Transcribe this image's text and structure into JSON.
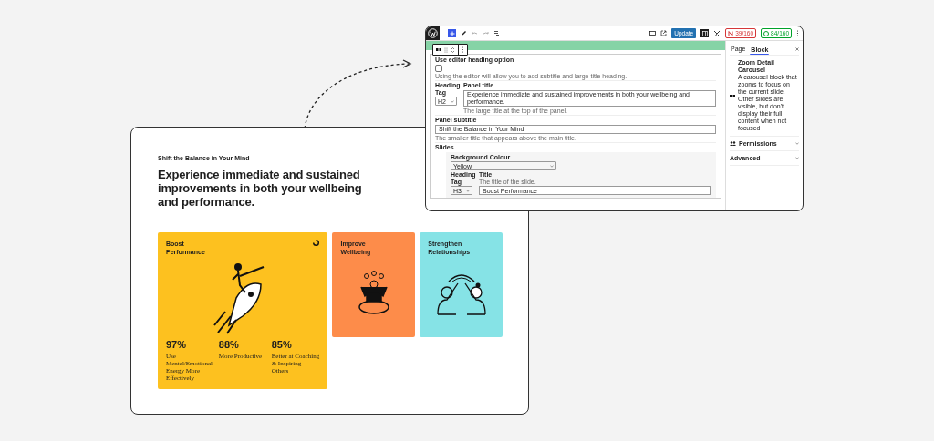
{
  "page_preview": {
    "subtitle": "Shift the Balance in Your Mind",
    "title": "Experience immediate and sustained improvements in both your wellbeing and performance.",
    "cards": [
      {
        "kind": "rocket",
        "title": "Boost Performance",
        "color": "#fdc11f",
        "expanded": true,
        "stats": [
          {
            "value": "97%",
            "label": "Use Mental/Emotional Energy More Effectively"
          },
          {
            "value": "88%",
            "label": "More Productive"
          },
          {
            "value": "85%",
            "label": "Better at Coaching & Inspiring Others"
          }
        ]
      },
      {
        "kind": "meditation",
        "title": "Improve Wellbeing",
        "color": "#fd8c4a",
        "expanded": false
      },
      {
        "kind": "high-five",
        "title": "Strengthen Relationships",
        "color": "#86e3e6",
        "expanded": false
      }
    ]
  },
  "editor": {
    "update_button": "Update",
    "badges": [
      {
        "text": "39/160",
        "color": "#d63638"
      },
      {
        "text": "84/160",
        "color": "#00a32a"
      }
    ],
    "form": {
      "editor_heading": {
        "label": "Use editor heading option",
        "checked": false,
        "help": "Using the editor will allow you to add subtitle and large title heading."
      },
      "heading_tag": {
        "label": "Heading Tag",
        "value": "H2"
      },
      "panel_title": {
        "label": "Panel title",
        "value": "Experience immediate and sustained improvements in both your wellbeing and performance.",
        "help": "The large title at the top of the panel."
      },
      "panel_subtitle": {
        "label": "Panel subtitle",
        "value": "Shift the Balance in Your Mind",
        "help": "The smaller title that appears above the main title."
      },
      "slides": {
        "label": "Slides",
        "background": {
          "label": "Background Colour",
          "value": "Yellow"
        },
        "heading_tag": {
          "label": "Heading Tag",
          "value": "H3"
        },
        "title": {
          "label": "Title",
          "help": "The title of the slide.",
          "value": "Boost Performance"
        }
      }
    },
    "sidebar": {
      "tabs": [
        {
          "label": "Page",
          "selected": false
        },
        {
          "label": "Block",
          "selected": true
        }
      ],
      "block": {
        "name": "Zoom Detail Carousel",
        "description": "A carousel block that zooms to focus on the current slide. Other slides are visible, but don't display their full content when not focused"
      },
      "panels": [
        {
          "kind": "permissions",
          "label": "Permissions"
        },
        {
          "kind": "plain",
          "label": "Advanced"
        }
      ]
    }
  }
}
